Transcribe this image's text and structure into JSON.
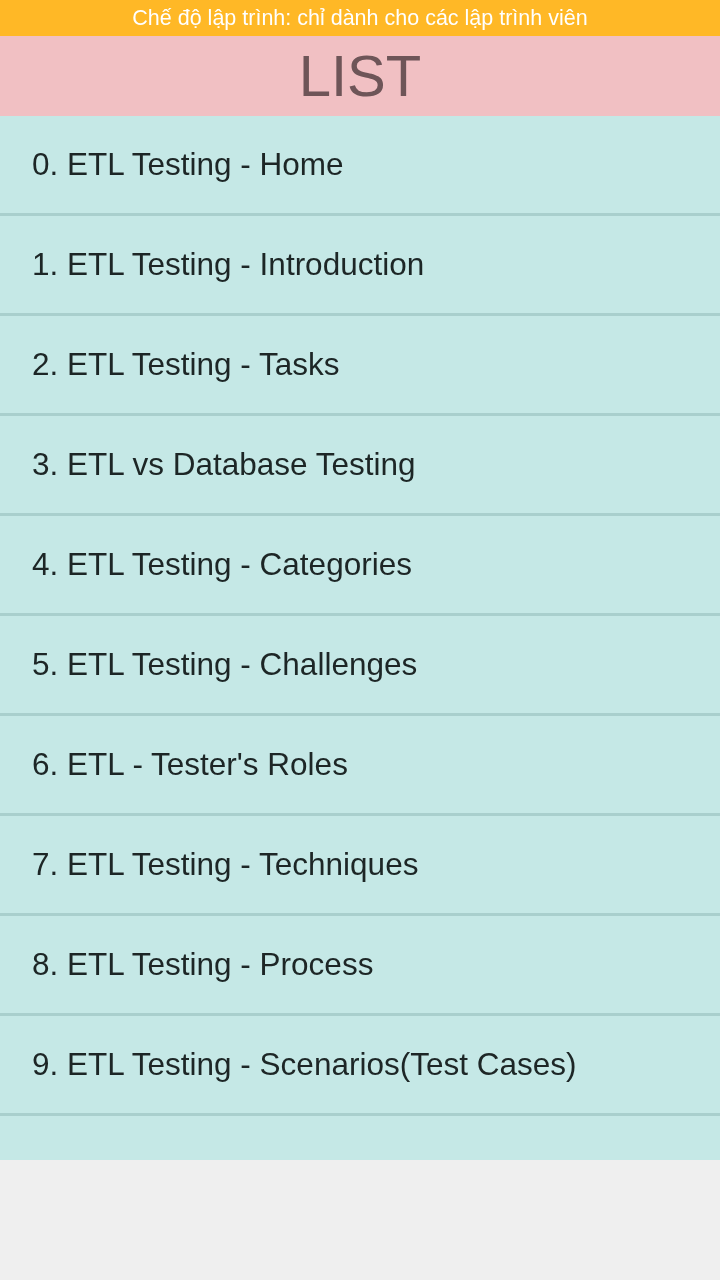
{
  "banner": {
    "text": "Chế độ lập trình: chỉ dành cho các lập trình viên"
  },
  "header": {
    "title": "LIST"
  },
  "items": [
    "0. ETL Testing - Home",
    "1. ETL Testing - Introduction",
    "2. ETL Testing - Tasks",
    "3. ETL vs Database Testing",
    "4. ETL Testing - Categories",
    "5. ETL Testing - Challenges",
    "6. ETL - Tester's Roles",
    "7. ETL Testing - Techniques",
    "8. ETL Testing - Process",
    "9. ETL Testing - Scenarios(Test Cases)"
  ]
}
